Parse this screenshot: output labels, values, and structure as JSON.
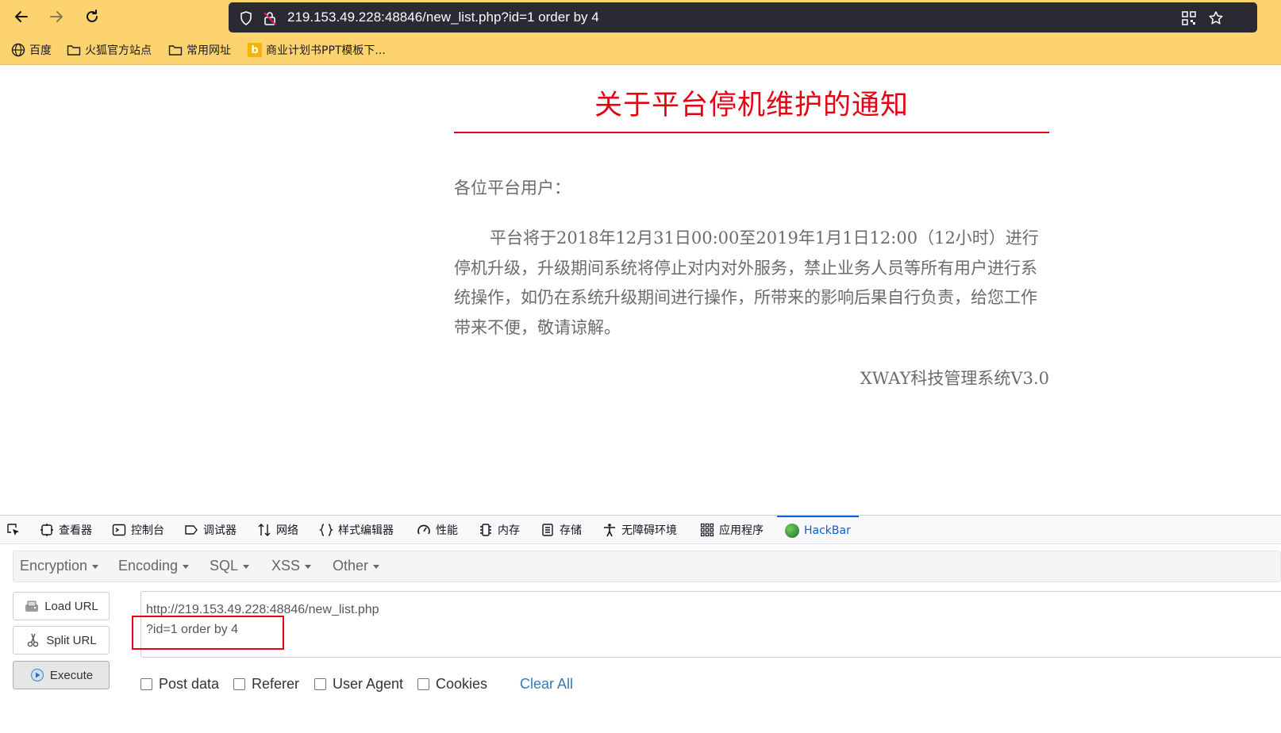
{
  "browser": {
    "url": "219.153.49.228:48846/new_list.php?id=1 order by 4",
    "bookmarks": [
      {
        "label": "百度",
        "icon": "globe-icon"
      },
      {
        "label": "火狐官方站点",
        "icon": "folder-icon"
      },
      {
        "label": "常用网址",
        "icon": "folder-icon"
      },
      {
        "label": "商业计划书PPT模板下...",
        "icon": "bing-icon"
      }
    ]
  },
  "page": {
    "title": "关于平台停机维护的通知",
    "greeting": "各位平台用户：",
    "body": "平台将于2018年12月31日00:00至2019年1月1日12:00（12小时）进行停机升级，升级期间系统将停止对内对外服务，禁止业务人员等所有用户进行系统操作，如仍在系统升级期间进行操作，所带来的影响后果自行负责，给您工作带来不便，敬请谅解。",
    "signature": "XWAY科技管理系统V3.0",
    "colors": {
      "title": "#e60012",
      "body": "#6b6b6b"
    }
  },
  "devtools": {
    "tabs": [
      {
        "label": "查看器",
        "icon": "inspector-icon"
      },
      {
        "label": "控制台",
        "icon": "console-icon"
      },
      {
        "label": "调试器",
        "icon": "debugger-icon"
      },
      {
        "label": "网络",
        "icon": "network-icon"
      },
      {
        "label": "样式编辑器",
        "icon": "style-editor-icon"
      },
      {
        "label": "性能",
        "icon": "performance-icon"
      },
      {
        "label": "内存",
        "icon": "memory-icon"
      },
      {
        "label": "存储",
        "icon": "storage-icon"
      },
      {
        "label": "无障碍环境",
        "icon": "accessibility-icon"
      },
      {
        "label": "应用程序",
        "icon": "application-icon"
      },
      {
        "label": "HackBar",
        "icon": "hackbar-icon",
        "active": true
      }
    ]
  },
  "hackbar": {
    "menu": [
      "Encryption",
      "Encoding",
      "SQL",
      "XSS",
      "Other"
    ],
    "buttons": {
      "load": "Load URL",
      "split": "Split URL",
      "execute": "Execute"
    },
    "url_line1": "http://219.153.49.228:48846/new_list.php",
    "url_line2": "?id=1 order by 4",
    "options": [
      "Post data",
      "Referer",
      "User Agent",
      "Cookies"
    ],
    "clear_all": "Clear All"
  }
}
